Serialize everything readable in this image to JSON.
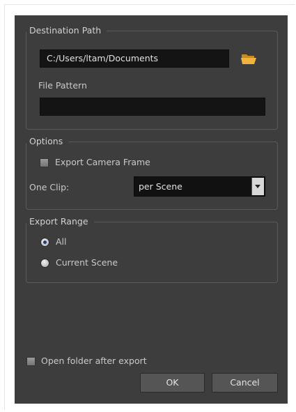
{
  "destination": {
    "title": "Destination Path",
    "path_value": "C:/Users/ltam/Documents",
    "file_pattern_label": "File Pattern",
    "file_pattern_value": "",
    "browse_icon": "folder-icon"
  },
  "options": {
    "title": "Options",
    "export_camera_frame_label": "Export Camera Frame",
    "export_camera_frame_checked": false,
    "one_clip_label": "One Clip:",
    "one_clip_value": "per Scene"
  },
  "export_range": {
    "title": "Export Range",
    "all_label": "All",
    "current_scene_label": "Current Scene",
    "selected": "All"
  },
  "footer": {
    "open_folder_label": "Open folder after export",
    "open_folder_checked": false,
    "ok_label": "OK",
    "cancel_label": "Cancel"
  },
  "colors": {
    "dialog_bg": "#3d3d3d",
    "field_bg": "#141414",
    "folder_icon": "#f2b33d"
  }
}
